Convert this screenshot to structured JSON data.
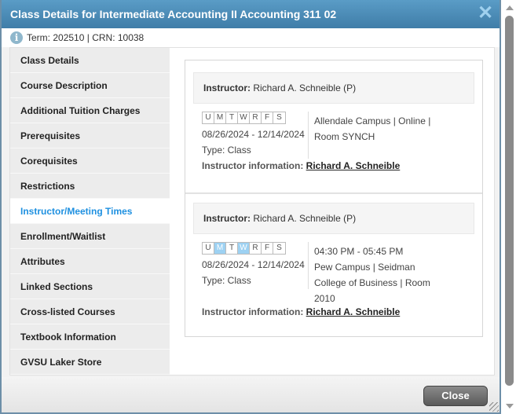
{
  "dialog": {
    "title": "Class Details for Intermediate Accounting II Accounting 311 02",
    "close_icon": "close-x-icon",
    "info_icon": "info-icon",
    "info": {
      "term_label": "Term",
      "term_value": "202510",
      "crn_label": "CRN",
      "crn_value": "10038"
    }
  },
  "sidebar": {
    "items": [
      {
        "label": "Class Details",
        "active": false
      },
      {
        "label": "Course Description",
        "active": false
      },
      {
        "label": "Additional Tuition Charges",
        "active": false
      },
      {
        "label": "Prerequisites",
        "active": false
      },
      {
        "label": "Corequisites",
        "active": false
      },
      {
        "label": "Restrictions",
        "active": false
      },
      {
        "label": "Instructor/Meeting Times",
        "active": true
      },
      {
        "label": "Enrollment/Waitlist",
        "active": false
      },
      {
        "label": "Attributes",
        "active": false
      },
      {
        "label": "Linked Sections",
        "active": false
      },
      {
        "label": "Cross-listed Courses",
        "active": false
      },
      {
        "label": "Textbook Information",
        "active": false
      },
      {
        "label": "GVSU Laker Store",
        "active": false
      }
    ]
  },
  "meetings": [
    {
      "instructor_label": "Instructor:",
      "instructor": "Richard A. Schneible (P)",
      "days": [
        {
          "letter": "U",
          "on": false
        },
        {
          "letter": "M",
          "on": false
        },
        {
          "letter": "T",
          "on": false
        },
        {
          "letter": "W",
          "on": false
        },
        {
          "letter": "R",
          "on": false
        },
        {
          "letter": "F",
          "on": false
        },
        {
          "letter": "S",
          "on": false
        }
      ],
      "date_range": "08/26/2024 - 12/14/2024",
      "type": "Type: Class",
      "time": "",
      "location_lines": [
        "Allendale Campus | Online |",
        "Room SYNCH"
      ],
      "instructor_info_label": "Instructor information:",
      "instructor_link": "Richard A. Schneible"
    },
    {
      "instructor_label": "Instructor:",
      "instructor": "Richard A. Schneible (P)",
      "days": [
        {
          "letter": "U",
          "on": false
        },
        {
          "letter": "M",
          "on": true
        },
        {
          "letter": "T",
          "on": false
        },
        {
          "letter": "W",
          "on": true
        },
        {
          "letter": "R",
          "on": false
        },
        {
          "letter": "F",
          "on": false
        },
        {
          "letter": "S",
          "on": false
        }
      ],
      "date_range": "08/26/2024 - 12/14/2024",
      "type": "Type: Class",
      "time": "04:30 PM - 05:45 PM",
      "location_lines": [
        "Pew Campus | Seidman",
        "College of Business | Room",
        "2010"
      ],
      "instructor_info_label": "Instructor information:",
      "instructor_link": "Richard A. Schneible"
    }
  ],
  "footer": {
    "close_label": "Close"
  },
  "colors": {
    "titlebar": "#4a8cb8",
    "active_nav": "#1e90e0",
    "day_on": "#9dd1f2"
  }
}
